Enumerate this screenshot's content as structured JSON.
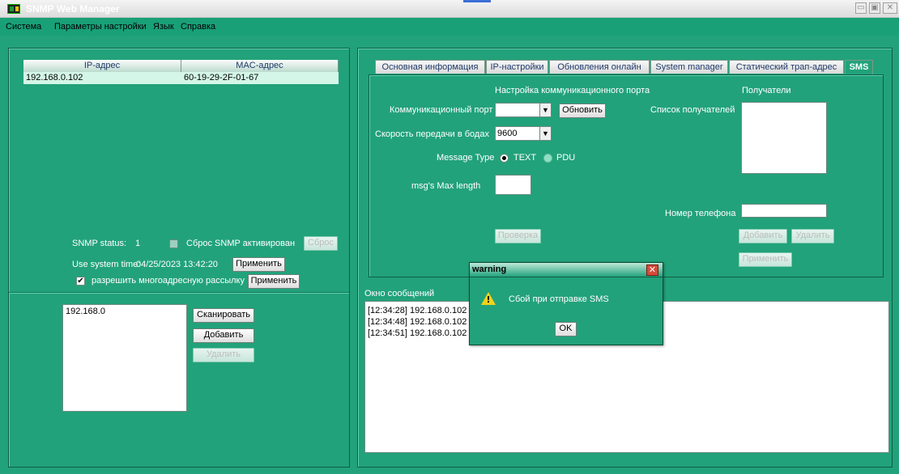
{
  "window": {
    "title": "SNMP Web Manager",
    "controls": [
      "▭",
      "▣",
      "✕"
    ]
  },
  "menu": [
    "Система",
    "Параметры настройки",
    "Язык",
    "Справка"
  ],
  "device_table": {
    "headers": [
      "IP-адрес",
      "MAC-адрес"
    ],
    "rows": [
      [
        "192.168.0.102",
        "60-19-29-2F-01-67"
      ]
    ]
  },
  "snmp": {
    "status_label": "SNMP status:",
    "status_value": "1",
    "reset_activated_label": "Сброс SNMP активирован",
    "reset_button": "Сброс",
    "system_time_label": "Use system time:",
    "system_time_value": "04/25/2023 13:42:20",
    "apply_button": "Применить",
    "multicast_label": "разрешить многоадресную рассылку",
    "multicast_apply_button": "Применить"
  },
  "scan": {
    "ip_list_value": "192.168.0",
    "scan_button": "Сканировать",
    "add_button": "Добавить",
    "delete_button": "Удалить"
  },
  "tabs": [
    {
      "label": "Основная информация",
      "active": false
    },
    {
      "label": "IP-настройки",
      "active": false
    },
    {
      "label": "Обновления онлайн",
      "active": false
    },
    {
      "label": "System manager",
      "active": false
    },
    {
      "label": "Статический трап-адрес",
      "active": false
    },
    {
      "label": "SMS",
      "active": true
    }
  ],
  "sms": {
    "port_section_title": "Настройка коммуникационного порта",
    "port_label": "Коммуникационный порт",
    "port_value": "",
    "refresh_button": "Обновить",
    "baud_label": "Скорость передачи в бодах",
    "baud_value": "9600",
    "message_type_label": "Message Type",
    "message_type_options": [
      "TEXT",
      "PDU"
    ],
    "message_type_selected": "TEXT",
    "max_length_label": "msg's Max length",
    "max_length_value": "",
    "check_button": "Проверка",
    "recipients_title": "Получатели",
    "recipients_list_label": "Список получателей",
    "phone_label": "Номер телефона",
    "phone_value": "",
    "add_button": "Добавить",
    "delete_button": "Удалить",
    "apply_button": "Применить"
  },
  "log": {
    "title": "Окно сообщений",
    "lines": [
      "[12:34:28]  192.168.0.102",
      "[12:34:48]  192.168.0.102",
      "[12:34:51]  192.168.0.102"
    ]
  },
  "dialog": {
    "title": "warning",
    "message": "Сбой при отправке SMS",
    "ok_button": "OK"
  },
  "colors": {
    "background": "#22a27a",
    "white_field": "#ffffff",
    "selected_row": "#d4f6e8",
    "close_red": "#d84a3a",
    "warning_yellow": "#f2d21a"
  }
}
